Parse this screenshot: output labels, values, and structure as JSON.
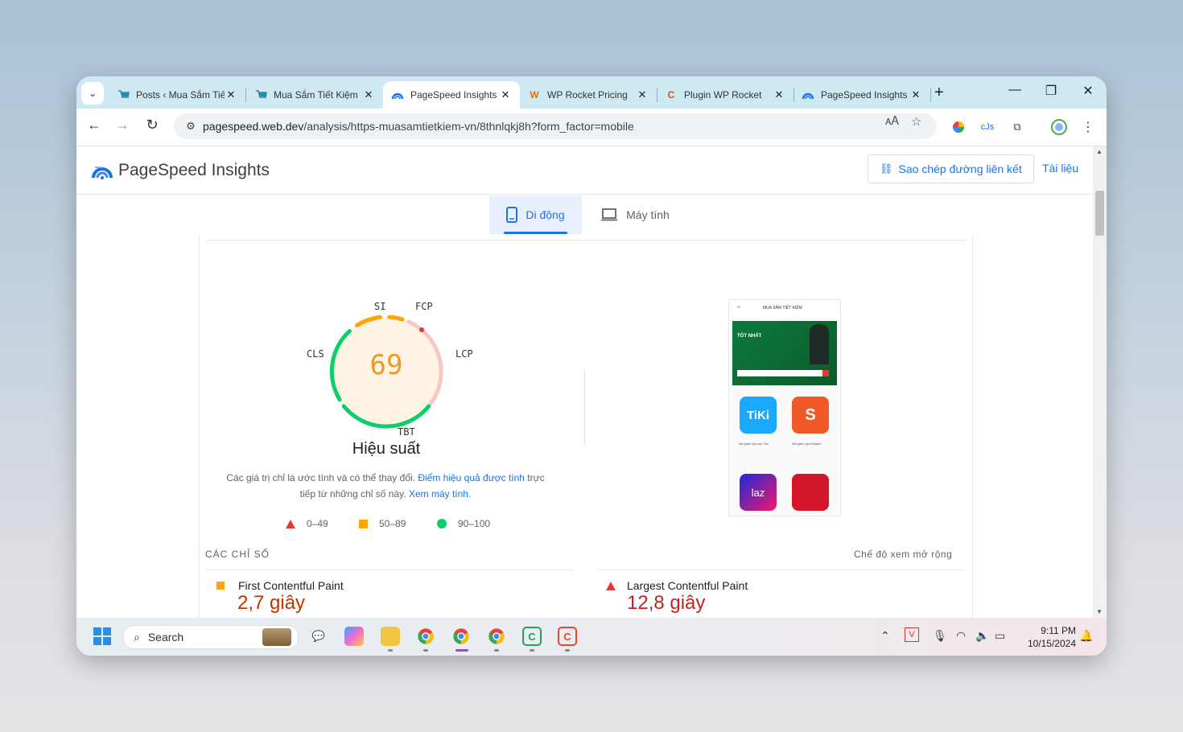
{
  "tabs": [
    {
      "title": "Posts ‹ Mua Sắm Tiết Kiệm",
      "favicon": "cart-icon"
    },
    {
      "title": "Mua Sắm Tiết Kiệm",
      "favicon": "cart-icon"
    },
    {
      "title": "PageSpeed Insights",
      "favicon": "pagespeed-icon"
    },
    {
      "title": "WP Rocket Pricing",
      "favicon": "wp-rocket-icon"
    },
    {
      "title": "Plugin WP Rocket",
      "favicon": "c-logo-icon"
    },
    {
      "title": "PageSpeed Insights",
      "favicon": "pagespeed-icon"
    }
  ],
  "toolbar": {
    "url_host": "pagespeed.web.dev",
    "url_path": "/analysis/https-muasamtietkiem-vn/8thnlqkj8h?form_factor=mobile"
  },
  "psi": {
    "title": "PageSpeed Insights",
    "copy_link": "Sao chép đường liên kết",
    "docs": "Tài liệu",
    "tab_mobile": "Di động",
    "tab_desktop": "Máy tính",
    "score": "69",
    "score_color": "#ffa400",
    "gauge_labels": {
      "si": "SI",
      "fcp": "FCP",
      "lcp": "LCP",
      "tbt": "TBT",
      "cls": "CLS"
    },
    "perf_title": "Hiệu suất",
    "desc_part1": "Các giá trị chỉ là ước tính và có thể thay đổi. ",
    "desc_link1": "Điểm hiệu quả được tính",
    "desc_part2": " trực tiếp từ những chỉ số này. ",
    "desc_link2": "Xem máy tính.",
    "legend_fail": "0–49",
    "legend_average": "50–89",
    "legend_pass": "90–100",
    "metrics_heading": "CÁC CHỈ SỐ",
    "expand_label": "Chế độ xem mở rộng",
    "metrics": [
      {
        "name": "First Contentful Paint",
        "value": "2,7 giây",
        "status": "average"
      },
      {
        "name": "Largest Contentful Paint",
        "value": "12,8 giây",
        "status": "fail"
      }
    ]
  },
  "thumbnail": {
    "site_name": "MUA SẮM TIẾT KIỆM",
    "banner_text": "TỐT NHẤT",
    "tiki": "TiKi",
    "shopee": "S",
    "lazada": "laz",
    "tiki_caption": "Mã giảm giá sàn Tiki",
    "shopee_caption": "Mã giảm giá Shopee"
  },
  "taskbar": {
    "search_placeholder": "Search",
    "time": "9:11 PM",
    "date": "10/15/2024"
  },
  "colors": {
    "accent": "#1a73e8",
    "average": "#ffa400",
    "fail": "#e53935",
    "pass": "#0cce6b"
  }
}
